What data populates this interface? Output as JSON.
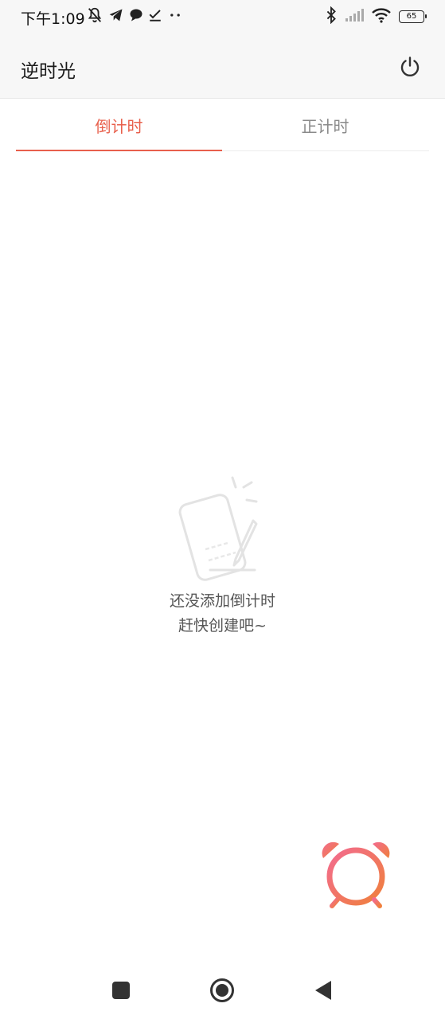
{
  "status_bar": {
    "time": "下午1:09",
    "battery": "65",
    "left_icons": [
      "bell-off-icon",
      "telegram-icon",
      "chat-icon",
      "check-icon",
      "more-dots-icon"
    ],
    "right_icons": [
      "bluetooth-icon",
      "signal-icon",
      "wifi-icon",
      "battery-icon"
    ]
  },
  "app_bar": {
    "title": "逆时光",
    "action_icon": "power-icon"
  },
  "tabs": [
    {
      "label": "倒计时",
      "active": true
    },
    {
      "label": "正计时",
      "active": false
    }
  ],
  "empty_state": {
    "line1": "还没添加倒计时",
    "line2": "赶快创建吧~",
    "icon": "empty-note-icon"
  },
  "fab": {
    "icon": "add-alarm-icon"
  },
  "nav_bar": {
    "icons": [
      "recent-apps-icon",
      "home-icon",
      "back-icon"
    ]
  },
  "colors": {
    "accent": "#e8604c",
    "header_bg": "#f7f7f7",
    "fab_gradient_start": "#f26b8f",
    "fab_gradient_end": "#f0803c"
  }
}
